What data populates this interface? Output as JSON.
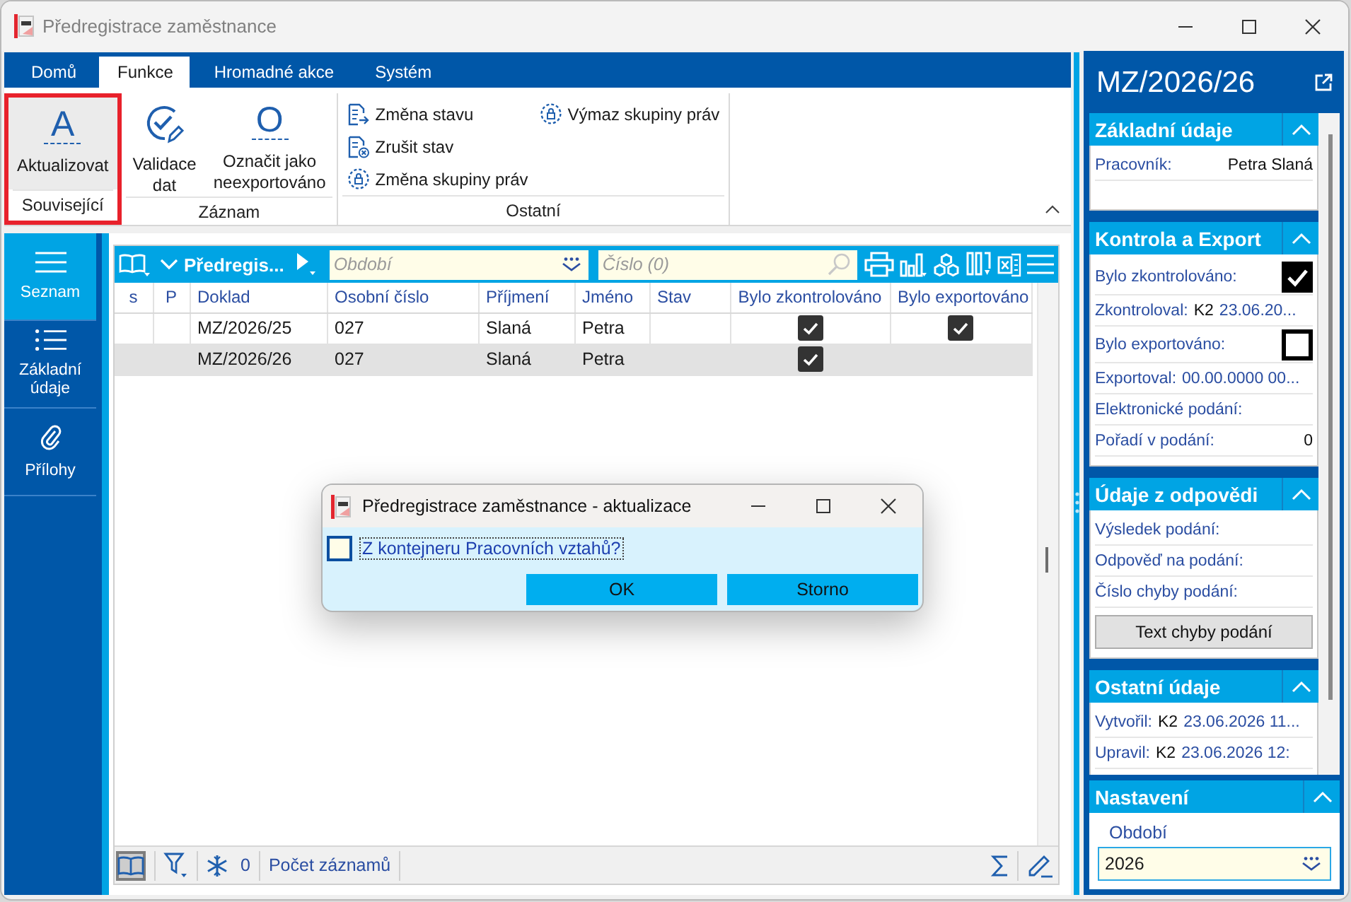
{
  "window": {
    "title": "Předregistrace zaměstnance"
  },
  "ribbon": {
    "tabs": [
      {
        "label": "Domů",
        "selected": false
      },
      {
        "label": "Funkce",
        "selected": true
      },
      {
        "label": "Hromadné akce",
        "selected": false
      },
      {
        "label": "Systém",
        "selected": false
      }
    ],
    "groups": [
      {
        "label": "Související",
        "highlighted": true,
        "items": [
          {
            "kind": "letter",
            "glyph": "A",
            "label": "Aktualizovat",
            "hovered": true
          }
        ]
      },
      {
        "label": "Záznam",
        "highlighted": false,
        "items": [
          {
            "kind": "check",
            "label": "Validace dat",
            "hovered": false
          },
          {
            "kind": "letter",
            "glyph": "O",
            "label": "Označit jako neexportováno",
            "hovered": false
          }
        ]
      },
      {
        "label": "Ostatní",
        "highlighted": false,
        "items": [
          {
            "kind": "change",
            "label": "Změna stavu",
            "hovered": false
          },
          {
            "kind": "cancel",
            "label": "Zrušit stav",
            "hovered": false
          },
          {
            "kind": "rights",
            "label": "Změna skupiny práv",
            "hovered": false
          },
          {
            "kind": "rights",
            "label": "Výmaz skupiny práv",
            "hovered": false
          }
        ]
      }
    ]
  },
  "nav": [
    {
      "label": "Seznam",
      "selected": true
    },
    {
      "label": "Základní údaje",
      "selected": false
    },
    {
      "label": "Přílohy",
      "selected": false
    }
  ],
  "list": {
    "title": "Předregis...",
    "filters": [
      {
        "kind": "period",
        "placeholder": "Období"
      },
      {
        "kind": "search",
        "placeholder": "Číslo (0)"
      }
    ],
    "columns": [
      "s",
      "P",
      "Doklad",
      "Osobní číslo",
      "Příjmení",
      "Jméno",
      "Stav",
      "Bylo zkontrolováno",
      "Bylo exportováno"
    ],
    "rows": [
      {
        "document": "MZ/2026/25",
        "personal_number": "027",
        "surname": "Slaná",
        "first_name": "Petra",
        "checked": true,
        "exported": true,
        "selected": false
      },
      {
        "document": "MZ/2026/26",
        "personal_number": "027",
        "surname": "Slaná",
        "first_name": "Petra",
        "checked": true,
        "exported": false,
        "selected": true
      }
    ],
    "footer": {
      "view_toggle": {
        "pressed": true
      },
      "count": "0",
      "count_label": "Počet záznamů"
    }
  },
  "dialog": {
    "title": "Předregistrace zaměstnance - aktualizace",
    "option": {
      "label": "Z kontejneru Pracovních vztahů?",
      "checked": false,
      "focused": true
    },
    "buttons": [
      {
        "label": "OK"
      },
      {
        "label": "Storno"
      }
    ]
  },
  "detail": {
    "title": "MZ/2026/26",
    "sections": [
      {
        "title": "Základní údaje",
        "expanded": true,
        "rows": [
          {
            "kind": "text",
            "label": "Pracovník:",
            "value": "Petra Slaná"
          }
        ]
      },
      {
        "title": "Kontrola a Export",
        "expanded": true,
        "rows": [
          {
            "kind": "check",
            "label": "Bylo zkontrolováno:",
            "checked": true
          },
          {
            "kind": "stamp",
            "label": "Zkontroloval:",
            "user": "K2",
            "date": "23.06.20..."
          },
          {
            "kind": "check",
            "label": "Bylo exportováno:",
            "checked": false
          },
          {
            "kind": "stamp",
            "label": "Exportoval:",
            "date": "00.00.0000 00..."
          },
          {
            "kind": "text",
            "label": "Elektronické podání:"
          },
          {
            "kind": "text",
            "label": "Pořadí v podání:",
            "value": "0"
          }
        ]
      },
      {
        "title": "Údaje z odpovědi",
        "expanded": true,
        "rows": [
          {
            "kind": "text",
            "label": "Výsledek podání:"
          },
          {
            "kind": "text",
            "label": "Odpověď na podání:"
          },
          {
            "kind": "text",
            "label": "Číslo chyby podání:"
          },
          {
            "kind": "button",
            "label": "Text chyby podání"
          }
        ]
      },
      {
        "title": "Ostatní údaje",
        "expanded": true,
        "rows": [
          {
            "kind": "stamp",
            "label": "Vytvořil:",
            "user": "K2",
            "date": "23.06.2026 11..."
          },
          {
            "kind": "stamp",
            "label": "Upravil:",
            "user": "K2",
            "date": "23.06.2026 12:"
          }
        ]
      }
    ]
  },
  "settings": {
    "title": "Nastavení",
    "expanded": true,
    "field_label": "Období",
    "value": "2026"
  }
}
